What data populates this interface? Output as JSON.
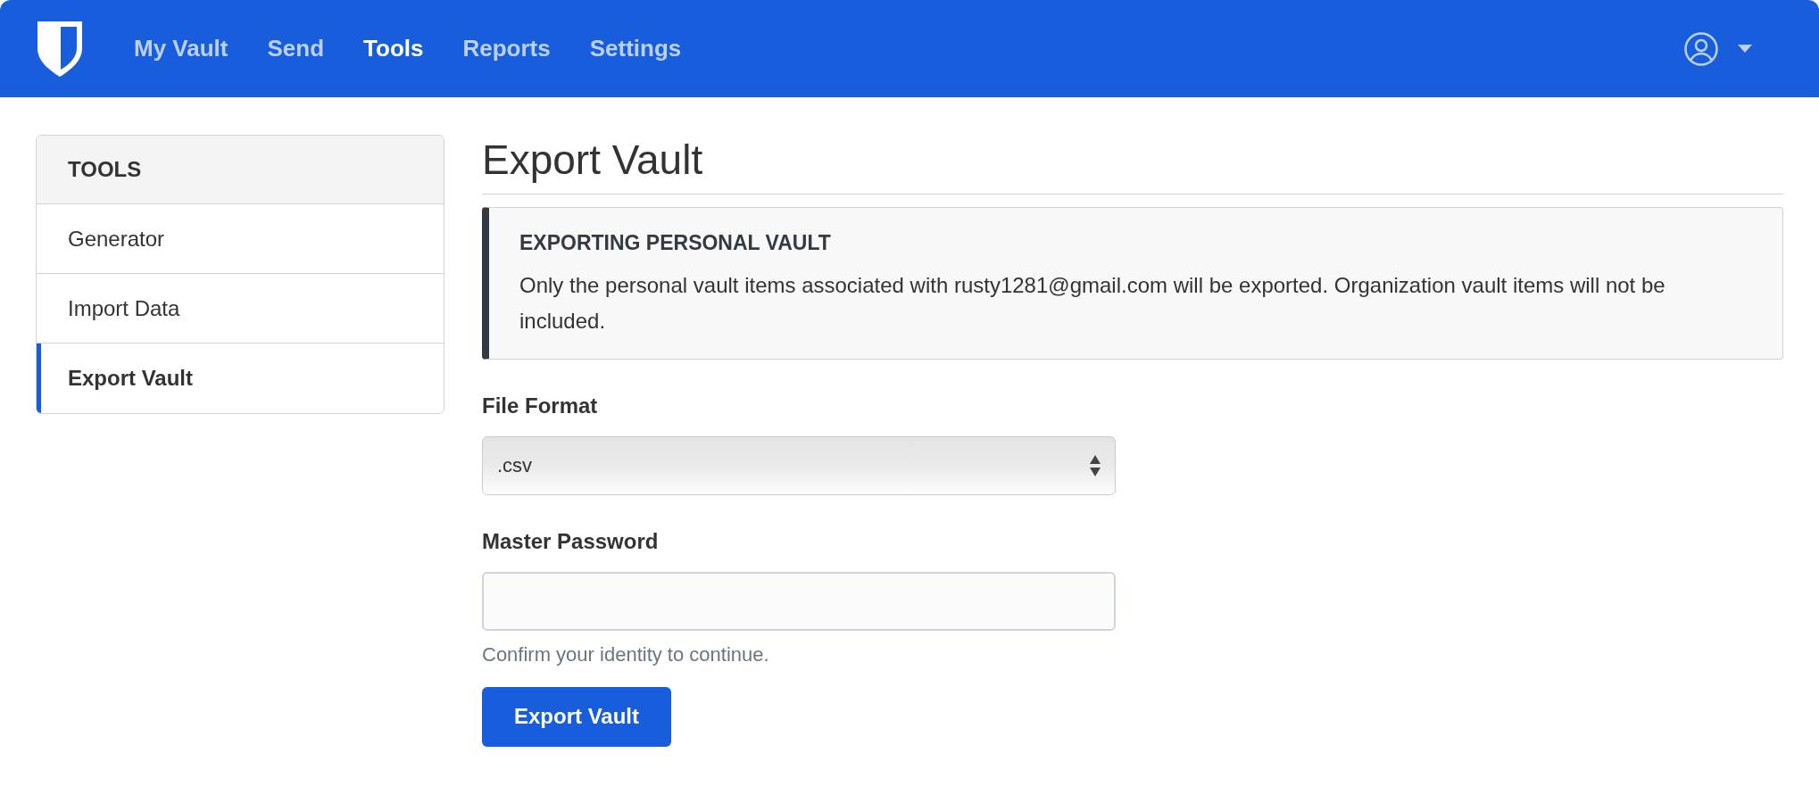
{
  "nav": {
    "items": [
      {
        "label": "My Vault",
        "selected": false
      },
      {
        "label": "Send",
        "selected": false
      },
      {
        "label": "Tools",
        "selected": true
      },
      {
        "label": "Reports",
        "selected": false
      },
      {
        "label": "Settings",
        "selected": false
      }
    ]
  },
  "sidebar": {
    "title": "TOOLS",
    "items": [
      {
        "label": "Generator",
        "selected": false
      },
      {
        "label": "Import Data",
        "selected": false
      },
      {
        "label": "Export Vault",
        "selected": true
      }
    ]
  },
  "page": {
    "title": "Export Vault",
    "callout": {
      "title": "EXPORTING PERSONAL VAULT",
      "text": "Only the personal vault items associated with rusty1281@gmail.com will be exported. Organization vault items will not be included."
    },
    "file_format": {
      "label": "File Format",
      "value": ".csv"
    },
    "master_password": {
      "label": "Master Password",
      "help": "Confirm your identity to continue."
    },
    "submit": "Export Vault"
  }
}
